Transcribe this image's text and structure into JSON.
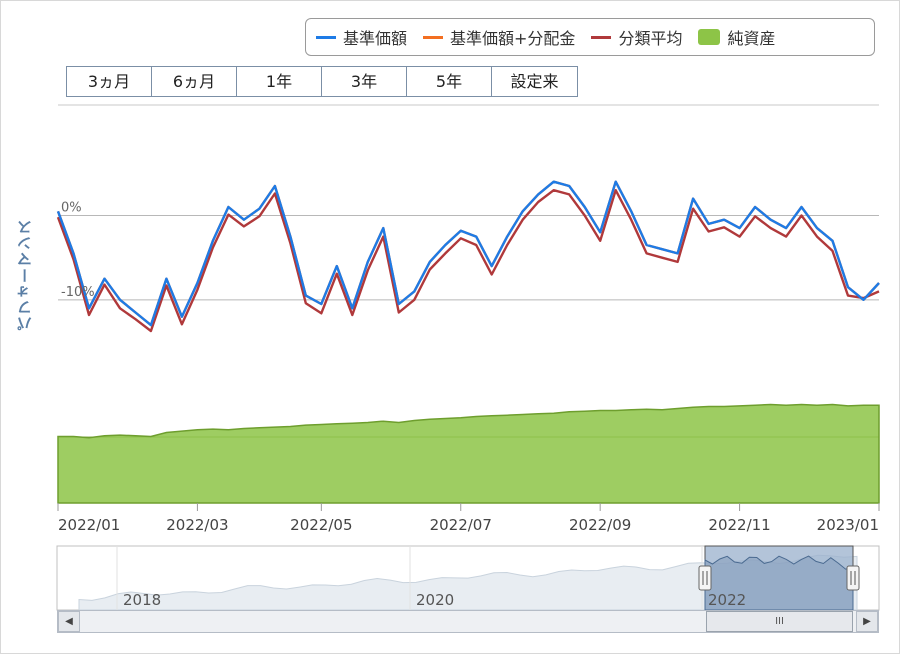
{
  "legend": [
    {
      "label": "基準価額",
      "color": "#1e7be6",
      "kind": "line"
    },
    {
      "label": "基準価額+分配金",
      "color": "#f36f21",
      "kind": "line"
    },
    {
      "label": "分類平均",
      "color": "#b0393b",
      "kind": "line"
    },
    {
      "label": "純資産",
      "color": "#8dc447",
      "kind": "area"
    }
  ],
  "range_buttons": [
    "3ヵ月",
    "6ヵ月",
    "1年",
    "3年",
    "5年",
    "設定来"
  ],
  "y_axis_title": "パフォーマンス",
  "navigator": {
    "years": [
      "2018",
      "2020",
      "2022"
    ],
    "scroll_left_icon": "left-arrow-icon",
    "scroll_right_icon": "right-arrow-icon",
    "thumb_grip": "III"
  },
  "chart_data": {
    "type": "line",
    "x_ticks": [
      "2022/01",
      "2022/03",
      "2022/05",
      "2022/07",
      "2022/09",
      "2022/11",
      "2023/01"
    ],
    "y_ticks": [
      "0%",
      "-10%"
    ],
    "ylim": [
      -15,
      8
    ],
    "grid": true,
    "x": [
      "2022-01-03",
      "2022-01-10",
      "2022-01-17",
      "2022-01-24",
      "2022-01-31",
      "2022-02-07",
      "2022-02-14",
      "2022-02-21",
      "2022-02-28",
      "2022-03-07",
      "2022-03-14",
      "2022-03-21",
      "2022-03-28",
      "2022-04-04",
      "2022-04-11",
      "2022-04-18",
      "2022-04-25",
      "2022-05-02",
      "2022-05-09",
      "2022-05-16",
      "2022-05-23",
      "2022-05-30",
      "2022-06-06",
      "2022-06-13",
      "2022-06-20",
      "2022-06-27",
      "2022-07-04",
      "2022-07-11",
      "2022-07-18",
      "2022-07-25",
      "2022-08-01",
      "2022-08-08",
      "2022-08-15",
      "2022-08-22",
      "2022-08-29",
      "2022-09-05",
      "2022-09-12",
      "2022-09-19",
      "2022-09-26",
      "2022-10-03",
      "2022-10-10",
      "2022-10-17",
      "2022-10-24",
      "2022-10-31",
      "2022-11-07",
      "2022-11-14",
      "2022-11-21",
      "2022-11-28",
      "2022-12-05",
      "2022-12-12",
      "2022-12-19",
      "2022-12-26",
      "2023-01-02",
      "2023-01-09"
    ],
    "series": [
      {
        "name": "基準価額",
        "color": "#1e7be6",
        "values": [
          0.5,
          -4.5,
          -11.0,
          -7.5,
          -10.0,
          -11.5,
          -13.0,
          -7.5,
          -12.0,
          -8.0,
          -3.0,
          1.0,
          -0.5,
          0.8,
          3.5,
          -2.5,
          -9.5,
          -10.5,
          -6.0,
          -11.0,
          -5.5,
          -1.5,
          -10.5,
          -9.0,
          -5.5,
          -3.5,
          -1.8,
          -2.5,
          -6.0,
          -2.5,
          0.5,
          2.5,
          4.0,
          3.5,
          1.0,
          -2.0,
          4.0,
          0.5,
          -3.5,
          -4.0,
          -4.5,
          2.0,
          -1.0,
          -0.5,
          -1.5,
          1.0,
          -0.5,
          -1.5,
          1.0,
          -1.5,
          -3.0,
          -8.5,
          -10.0,
          -8.0
        ]
      },
      {
        "name": "基準価額+分配金",
        "color": "#f36f21",
        "values": [
          0.5,
          -4.5,
          -11.0,
          -7.5,
          -10.0,
          -11.5,
          -13.0,
          -7.5,
          -12.0,
          -8.0,
          -3.0,
          1.0,
          -0.5,
          0.8,
          3.5,
          -2.5,
          -9.5,
          -10.5,
          -6.0,
          -11.0,
          -5.5,
          -1.5,
          -10.5,
          -9.0,
          -5.5,
          -3.5,
          -1.8,
          -2.5,
          -6.0,
          -2.5,
          0.5,
          2.5,
          4.0,
          3.5,
          1.0,
          -2.0,
          4.0,
          0.5,
          -3.5,
          -4.0,
          -4.5,
          2.0,
          -1.0,
          -0.5,
          -1.5,
          1.0,
          -0.5,
          -1.5,
          1.0,
          -1.5,
          -3.0,
          -8.5,
          -10.0,
          -8.0
        ]
      },
      {
        "name": "分類平均",
        "color": "#b0393b",
        "values": [
          -0.2,
          -5.2,
          -11.8,
          -8.2,
          -11.0,
          -12.3,
          -13.7,
          -8.3,
          -12.9,
          -8.8,
          -3.8,
          0.1,
          -1.3,
          -0.1,
          2.6,
          -3.3,
          -10.4,
          -11.6,
          -6.9,
          -11.8,
          -6.5,
          -2.5,
          -11.5,
          -10.0,
          -6.4,
          -4.5,
          -2.7,
          -3.5,
          -7.0,
          -3.5,
          -0.5,
          1.6,
          3.0,
          2.5,
          0.0,
          -3.0,
          3.0,
          -0.5,
          -4.5,
          -5.0,
          -5.5,
          0.8,
          -1.9,
          -1.4,
          -2.5,
          -0.1,
          -1.5,
          -2.5,
          0.0,
          -2.5,
          -4.2,
          -9.5,
          -9.8,
          -9.0
        ]
      }
    ],
    "net_assets": {
      "name": "純資産",
      "color": "#8dc447",
      "values": [
        100,
        100,
        98,
        101,
        102,
        101,
        100,
        106,
        108,
        110,
        111,
        110,
        112,
        113,
        114,
        115,
        117,
        118,
        119,
        120,
        121,
        123,
        121,
        124,
        126,
        127,
        128,
        130,
        131,
        132,
        133,
        134,
        135,
        137,
        138,
        139,
        139,
        140,
        141,
        140,
        142,
        144,
        145,
        145,
        146,
        147,
        148,
        147,
        148,
        147,
        148,
        146,
        147,
        147
      ]
    }
  }
}
